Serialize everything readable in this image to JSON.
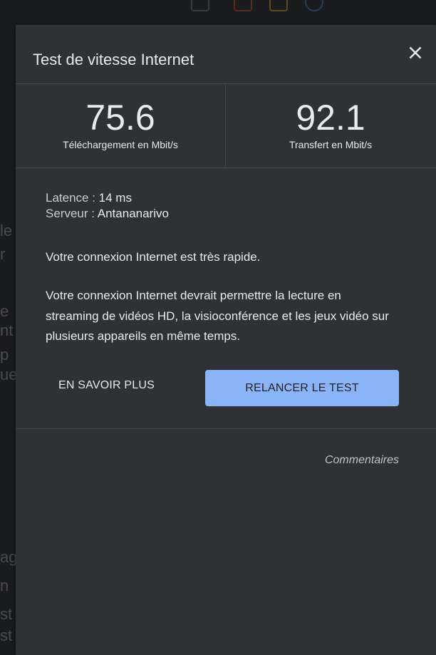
{
  "dialog": {
    "title": "Test de vitesse Internet",
    "download": {
      "value": "75.6",
      "unit_label": "Téléchargement en Mbit/s"
    },
    "upload": {
      "value": "92.1",
      "unit_label": "Transfert en Mbit/s"
    },
    "latency": {
      "label": "Latence : ",
      "value": "14 ms"
    },
    "server": {
      "label": "Serveur : ",
      "value": "Antananarivo"
    },
    "speed_summary": "Votre connexion Internet est très rapide.",
    "speed_details": "Votre connexion Internet devrait permettre la lecture en streaming de vidéos HD, la visioconférence et les jeux vidéo sur plusieurs appareils en même temps.",
    "learn_more_label": "EN SAVOIR PLUS",
    "retest_label": "RELANCER LE TEST",
    "feedback_label": "Commentaires"
  },
  "colors": {
    "panel_bg": "#303134",
    "accent_button": "#8ab4f8",
    "text_primary": "#e8eaed"
  },
  "icons": {
    "close": "close-icon"
  }
}
